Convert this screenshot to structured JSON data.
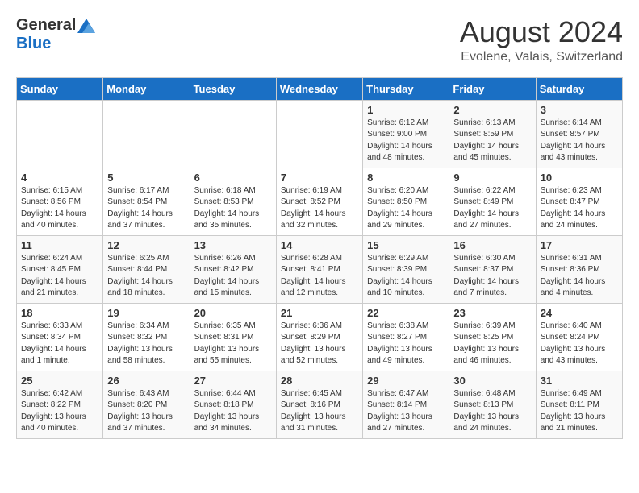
{
  "logo": {
    "general": "General",
    "blue": "Blue"
  },
  "title": {
    "month_year": "August 2024",
    "location": "Evolene, Valais, Switzerland"
  },
  "days_of_week": [
    "Sunday",
    "Monday",
    "Tuesday",
    "Wednesday",
    "Thursday",
    "Friday",
    "Saturday"
  ],
  "weeks": [
    [
      {
        "day": "",
        "info": ""
      },
      {
        "day": "",
        "info": ""
      },
      {
        "day": "",
        "info": ""
      },
      {
        "day": "",
        "info": ""
      },
      {
        "day": "1",
        "info": "Sunrise: 6:12 AM\nSunset: 9:00 PM\nDaylight: 14 hours\nand 48 minutes."
      },
      {
        "day": "2",
        "info": "Sunrise: 6:13 AM\nSunset: 8:59 PM\nDaylight: 14 hours\nand 45 minutes."
      },
      {
        "day": "3",
        "info": "Sunrise: 6:14 AM\nSunset: 8:57 PM\nDaylight: 14 hours\nand 43 minutes."
      }
    ],
    [
      {
        "day": "4",
        "info": "Sunrise: 6:15 AM\nSunset: 8:56 PM\nDaylight: 14 hours\nand 40 minutes."
      },
      {
        "day": "5",
        "info": "Sunrise: 6:17 AM\nSunset: 8:54 PM\nDaylight: 14 hours\nand 37 minutes."
      },
      {
        "day": "6",
        "info": "Sunrise: 6:18 AM\nSunset: 8:53 PM\nDaylight: 14 hours\nand 35 minutes."
      },
      {
        "day": "7",
        "info": "Sunrise: 6:19 AM\nSunset: 8:52 PM\nDaylight: 14 hours\nand 32 minutes."
      },
      {
        "day": "8",
        "info": "Sunrise: 6:20 AM\nSunset: 8:50 PM\nDaylight: 14 hours\nand 29 minutes."
      },
      {
        "day": "9",
        "info": "Sunrise: 6:22 AM\nSunset: 8:49 PM\nDaylight: 14 hours\nand 27 minutes."
      },
      {
        "day": "10",
        "info": "Sunrise: 6:23 AM\nSunset: 8:47 PM\nDaylight: 14 hours\nand 24 minutes."
      }
    ],
    [
      {
        "day": "11",
        "info": "Sunrise: 6:24 AM\nSunset: 8:45 PM\nDaylight: 14 hours\nand 21 minutes."
      },
      {
        "day": "12",
        "info": "Sunrise: 6:25 AM\nSunset: 8:44 PM\nDaylight: 14 hours\nand 18 minutes."
      },
      {
        "day": "13",
        "info": "Sunrise: 6:26 AM\nSunset: 8:42 PM\nDaylight: 14 hours\nand 15 minutes."
      },
      {
        "day": "14",
        "info": "Sunrise: 6:28 AM\nSunset: 8:41 PM\nDaylight: 14 hours\nand 12 minutes."
      },
      {
        "day": "15",
        "info": "Sunrise: 6:29 AM\nSunset: 8:39 PM\nDaylight: 14 hours\nand 10 minutes."
      },
      {
        "day": "16",
        "info": "Sunrise: 6:30 AM\nSunset: 8:37 PM\nDaylight: 14 hours\nand 7 minutes."
      },
      {
        "day": "17",
        "info": "Sunrise: 6:31 AM\nSunset: 8:36 PM\nDaylight: 14 hours\nand 4 minutes."
      }
    ],
    [
      {
        "day": "18",
        "info": "Sunrise: 6:33 AM\nSunset: 8:34 PM\nDaylight: 14 hours\nand 1 minute."
      },
      {
        "day": "19",
        "info": "Sunrise: 6:34 AM\nSunset: 8:32 PM\nDaylight: 13 hours\nand 58 minutes."
      },
      {
        "day": "20",
        "info": "Sunrise: 6:35 AM\nSunset: 8:31 PM\nDaylight: 13 hours\nand 55 minutes."
      },
      {
        "day": "21",
        "info": "Sunrise: 6:36 AM\nSunset: 8:29 PM\nDaylight: 13 hours\nand 52 minutes."
      },
      {
        "day": "22",
        "info": "Sunrise: 6:38 AM\nSunset: 8:27 PM\nDaylight: 13 hours\nand 49 minutes."
      },
      {
        "day": "23",
        "info": "Sunrise: 6:39 AM\nSunset: 8:25 PM\nDaylight: 13 hours\nand 46 minutes."
      },
      {
        "day": "24",
        "info": "Sunrise: 6:40 AM\nSunset: 8:24 PM\nDaylight: 13 hours\nand 43 minutes."
      }
    ],
    [
      {
        "day": "25",
        "info": "Sunrise: 6:42 AM\nSunset: 8:22 PM\nDaylight: 13 hours\nand 40 minutes."
      },
      {
        "day": "26",
        "info": "Sunrise: 6:43 AM\nSunset: 8:20 PM\nDaylight: 13 hours\nand 37 minutes."
      },
      {
        "day": "27",
        "info": "Sunrise: 6:44 AM\nSunset: 8:18 PM\nDaylight: 13 hours\nand 34 minutes."
      },
      {
        "day": "28",
        "info": "Sunrise: 6:45 AM\nSunset: 8:16 PM\nDaylight: 13 hours\nand 31 minutes."
      },
      {
        "day": "29",
        "info": "Sunrise: 6:47 AM\nSunset: 8:14 PM\nDaylight: 13 hours\nand 27 minutes."
      },
      {
        "day": "30",
        "info": "Sunrise: 6:48 AM\nSunset: 8:13 PM\nDaylight: 13 hours\nand 24 minutes."
      },
      {
        "day": "31",
        "info": "Sunrise: 6:49 AM\nSunset: 8:11 PM\nDaylight: 13 hours\nand 21 minutes."
      }
    ]
  ]
}
